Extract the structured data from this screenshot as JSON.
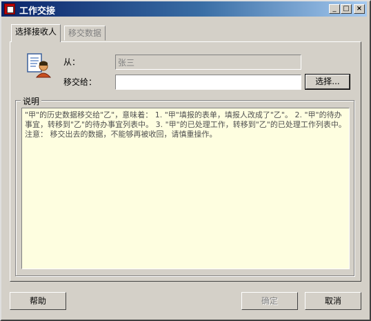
{
  "window": {
    "title": "工作交接",
    "controls": {
      "minimize": "_",
      "maximize": "□",
      "close": "×"
    }
  },
  "tabs": [
    {
      "label": "选择接收人",
      "active": true
    },
    {
      "label": "移交数据",
      "active": false
    }
  ],
  "form": {
    "from_label": "从：",
    "from_value": "张三",
    "to_label": "移交给：",
    "to_value": "",
    "select_button": "选择..."
  },
  "description": {
    "legend": "说明",
    "text": "\"甲\"的历史数据移交给\"乙\"，意味着： 1. \"甲\"填报的表单，填报人改成了\"乙\"。 2. \"甲\"的待办事宜，转移到\"乙\"的待办事宜列表中。 3. \"甲\"的已处理工作，转移到\"乙\"的已处理工作列表中。 注意： 移交出去的数据，不能够再被收回，请慎重操作。"
  },
  "footer": {
    "help_button": "帮助",
    "ok_button": "确定",
    "cancel_button": "取消"
  },
  "icons": {
    "app": "app-icon",
    "person": "person-document-icon"
  }
}
